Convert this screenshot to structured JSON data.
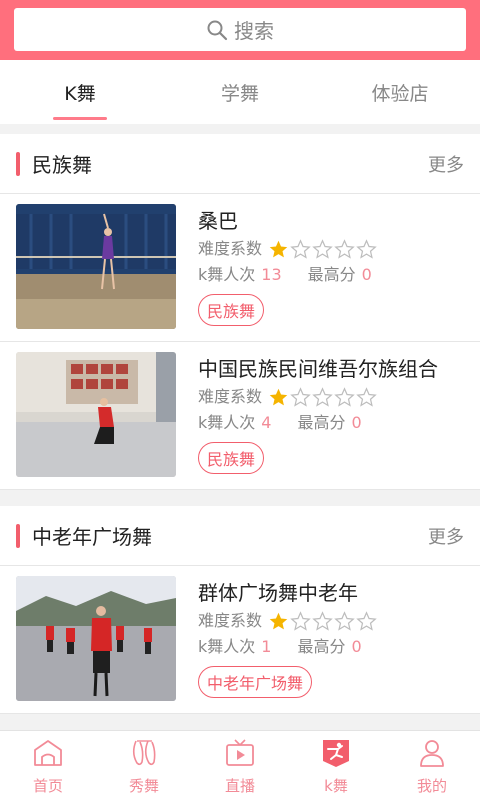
{
  "search": {
    "placeholder": "搜索"
  },
  "tabs": [
    {
      "label": "K舞",
      "active": true
    },
    {
      "label": "学舞",
      "active": false
    },
    {
      "label": "体验店",
      "active": false
    }
  ],
  "sections": [
    {
      "title": "民族舞",
      "more": "更多",
      "items": [
        {
          "title": "桑巴",
          "difficulty_label": "难度系数",
          "difficulty": 1,
          "plays_label": "k舞人次",
          "plays": "13",
          "best_label": "最高分",
          "best": "0",
          "tag": "民族舞"
        },
        {
          "title": "中国民族民间维吾尔族组合",
          "difficulty_label": "难度系数",
          "difficulty": 1,
          "plays_label": "k舞人次",
          "plays": "4",
          "best_label": "最高分",
          "best": "0",
          "tag": "民族舞"
        }
      ]
    },
    {
      "title": "中老年广场舞",
      "more": "更多",
      "items": [
        {
          "title": "群体广场舞中老年",
          "difficulty_label": "难度系数",
          "difficulty": 1,
          "plays_label": "k舞人次",
          "plays": "1",
          "best_label": "最高分",
          "best": "0",
          "tag": "中老年广场舞"
        }
      ]
    }
  ],
  "bottom_nav": [
    {
      "label": "首页",
      "icon": "home-icon"
    },
    {
      "label": "秀舞",
      "icon": "ballet-shoes-icon"
    },
    {
      "label": "直播",
      "icon": "tv-play-icon"
    },
    {
      "label": "k舞",
      "icon": "dancer-icon",
      "active": true
    },
    {
      "label": "我的",
      "icon": "user-icon"
    }
  ],
  "colors": {
    "accent": "#ff6f7d",
    "tag": "#f25e6c",
    "star": "#f5b400",
    "nav": "#f28b97"
  }
}
